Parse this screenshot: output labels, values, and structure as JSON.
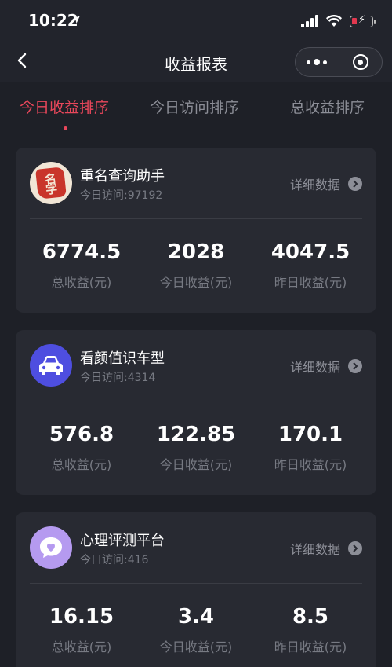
{
  "status_bar": {
    "time": "10:22"
  },
  "nav": {
    "title": "收益报表"
  },
  "tabs": [
    {
      "label": "今日收益排序",
      "active": true
    },
    {
      "label": "今日访问排序",
      "active": false
    },
    {
      "label": "总收益排序",
      "active": false
    }
  ],
  "detail_label": "详细数据",
  "colors": {
    "accent": "#e9475b",
    "background": "#1e2027",
    "card": "#282a32"
  },
  "cards": [
    {
      "icon": "name-seal-icon",
      "icon_text": "名字",
      "name": "重名查询助手",
      "visits": "今日访问:97192",
      "stats": [
        {
          "value": "6774.5",
          "label": "总收益(元)"
        },
        {
          "value": "2028",
          "label": "今日收益(元)"
        },
        {
          "value": "4047.5",
          "label": "昨日收益(元)"
        }
      ]
    },
    {
      "icon": "car-icon",
      "name": "看颜值识车型",
      "visits": "今日访问:4314",
      "stats": [
        {
          "value": "576.8",
          "label": "总收益(元)"
        },
        {
          "value": "122.85",
          "label": "今日收益(元)"
        },
        {
          "value": "170.1",
          "label": "昨日收益(元)"
        }
      ]
    },
    {
      "icon": "heart-chat-icon",
      "name": "心理评测平台",
      "visits": "今日访问:416",
      "stats": [
        {
          "value": "16.15",
          "label": "总收益(元)"
        },
        {
          "value": "3.4",
          "label": "今日收益(元)"
        },
        {
          "value": "8.5",
          "label": "昨日收益(元)"
        }
      ]
    }
  ]
}
